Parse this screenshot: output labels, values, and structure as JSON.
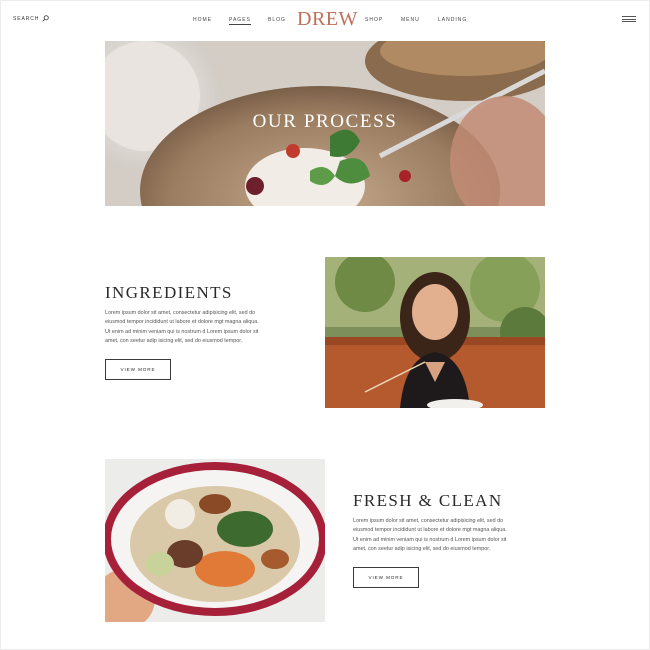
{
  "header": {
    "search_label": "SEARCH",
    "logo": "DREW",
    "nav": [
      "HOME",
      "PAGES",
      "BLOG",
      "SHOP",
      "MENU",
      "LANDING"
    ],
    "active_nav": "PAGES"
  },
  "hero": {
    "title": "OUR PROCESS"
  },
  "sections": [
    {
      "title": "INGREDIENTS",
      "text_lines": [
        "Lorem ipsum dolor sit amet, consectetur adipisicing elit, sed do",
        "eiusmod tempor incididunt ut labore et dolore mgt magna aliqua.",
        "Ut enim ad minim veniam qui is nostrum d Lorem ipsum dolor sit",
        "amet, con seetur adip isicing elit, sed do eiusmod tempor."
      ],
      "button": "VIEW MORE"
    },
    {
      "title": "FRESH & CLEAN",
      "text_lines": [
        "Lorem ipsum dolor sit amet, consectetur adipisicing elit, sed do",
        "eiusmod tempor incididunt ut labore et dolore mgt magna aliqua.",
        "Ut enim ad minim veniam qui is nostrum d Lorem ipsum dolor sit",
        "amet, con seetur adip isicing elit, sed do eiusmod tempor."
      ],
      "button": "VIEW MORE"
    }
  ],
  "icons": {
    "search": "search-icon",
    "menu": "hamburger-menu-icon"
  },
  "colors": {
    "logo": "#c0705a",
    "text": "#2b2b2b",
    "body_text": "#555555"
  }
}
